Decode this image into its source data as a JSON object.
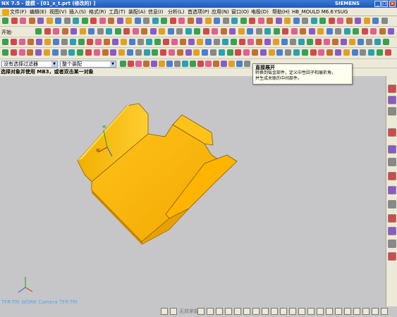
{
  "window": {
    "title": "NX 7.5 - 建模 - [01_x_t.prt (修改的) ]",
    "brand": "SIEMENS",
    "minimize": "_",
    "restore": "❐",
    "close": "×"
  },
  "menu": [
    "文件(F)",
    "编辑(E)",
    "视图(V)",
    "插入(S)",
    "格式(R)",
    "工具(T)",
    "装配(A)",
    "信息(I)",
    "分析(L)",
    "首选项(P)",
    "应用(N)",
    "窗口(O)",
    "电极(D)",
    "帮助(H)",
    "HB_MOULD M6.6",
    "YSUG"
  ],
  "toolbar": {
    "start_label": "开始·"
  },
  "selection": {
    "filter": "没有选择过滤器",
    "scope": "整个装配"
  },
  "cue_line": "选择对象并使用 MB3，或者双击某一对象",
  "tooltip": {
    "title": "直接展开",
    "body_line1": "转换到钣金部件，定义中性因子和展折角，",
    "body_line2": "并生成关联的中间部件。"
  },
  "viewport": {
    "wcs_x": "XC",
    "wcs_y": "YC",
    "view_label": "TFR-TRI WORK Camera TFR-TRI",
    "part_color": "#f0ac00",
    "background": "#c6c6c8"
  },
  "statusbar": {
    "snap_label": "无效掌握"
  },
  "colors": {
    "title_blue": "#2358b8",
    "toolbar_bg": "#ece9d8"
  }
}
